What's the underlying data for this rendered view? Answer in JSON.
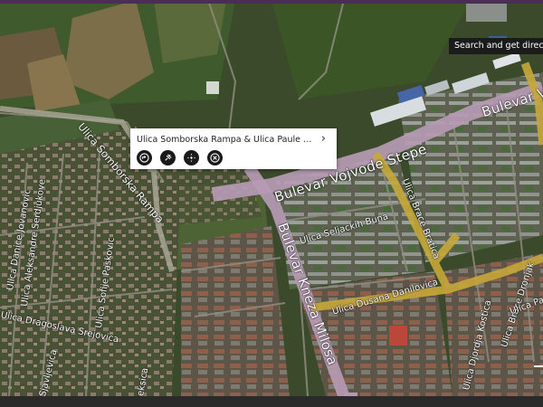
{
  "map": {
    "street_labels": [
      {
        "id": "bulevar-vojvode-stepe-1",
        "text": "Bulevar Vojvode Stepe"
      },
      {
        "id": "bulevar-vojvode-stepe-2",
        "text": "Bulevar Vo"
      },
      {
        "id": "bulevar-kneza-milosa",
        "text": "Bulevar Kneza Milosa"
      },
      {
        "id": "ulica-somborska-rampa",
        "text": "Ulica Somborska Rampa"
      },
      {
        "id": "ulica-seljackih-buna",
        "text": "Ulica Seljackih Buna"
      },
      {
        "id": "ulica-brace-bratica",
        "text": "Ulica Brace Bratica"
      },
      {
        "id": "ulica-dusana-danilovica",
        "text": "Ulica Dusana Danilovica"
      },
      {
        "id": "ulica-brace-dronjak",
        "text": "Ulica Brace Dronjak"
      },
      {
        "id": "ulica-djordja-kostica",
        "text": "Ulica Djordja Kostica"
      },
      {
        "id": "ulica-paule",
        "text": "Ulica Paule"
      },
      {
        "id": "ulica-dragoslava-srejovica",
        "text": "Ulica Dragoslava Srejovica"
      },
      {
        "id": "ulica-sofije-paskovic",
        "text": "Ulica Sofije Paskovic"
      },
      {
        "id": "ulica-aleksandre-serdjukove",
        "text": "Ulica Aleksandre Serdjukove"
      },
      {
        "id": "ulica-danice-jovanovic",
        "text": "Ulica Danice Jovanovic"
      },
      {
        "id": "ulica-sjavljevica",
        "text": "Sjavljevica"
      },
      {
        "id": "ulica-eksica",
        "text": "eksica"
      }
    ]
  },
  "popup": {
    "title": "Ulica Somborska Rampa & Ulica Paule Sosberger,...",
    "chevron": "›",
    "buttons": [
      {
        "id": "directions",
        "icon": "directions-icon"
      },
      {
        "id": "pin",
        "icon": "pin-icon"
      },
      {
        "id": "nearby",
        "icon": "nearby-icon"
      },
      {
        "id": "close",
        "icon": "close-icon"
      }
    ]
  },
  "search_button": {
    "label": "Search and get directions"
  },
  "colors": {
    "topbar": "#4b2e55",
    "major_road": "#b69ab4",
    "primary_road": "#c7a83a",
    "popup_bg": "#ffffff",
    "search_bg": "#1b1b1b"
  }
}
